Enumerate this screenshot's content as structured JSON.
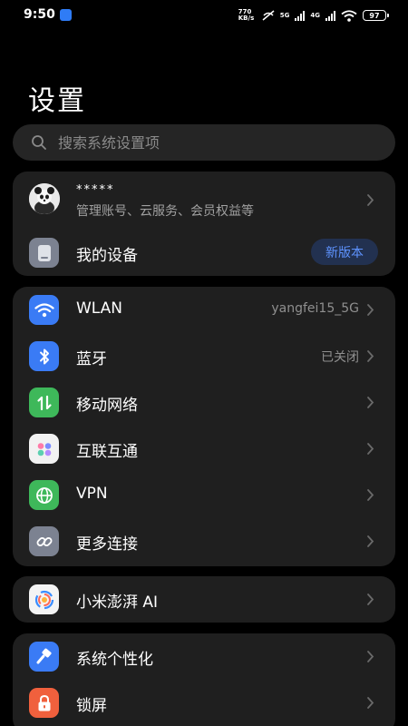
{
  "status_bar": {
    "time": "9:50",
    "net_speed_value": "770",
    "net_speed_unit": "KB/s",
    "sim1_type": "5G",
    "sim2_type": "4G",
    "battery": "97"
  },
  "page_title": "设置",
  "search": {
    "placeholder": "搜索系统设置项"
  },
  "account": {
    "name": "*****",
    "subtitle": "管理账号、云服务、会员权益等"
  },
  "my_device": {
    "label": "我的设备",
    "badge": "新版本"
  },
  "connections": [
    {
      "label": "WLAN",
      "value": "yangfei15_5G",
      "icon": "wifi-icon",
      "color": "#3a7bf5"
    },
    {
      "label": "蓝牙",
      "value": "已关闭",
      "icon": "bluetooth-icon",
      "color": "#3a7bf5"
    },
    {
      "label": "移动网络",
      "value": "",
      "icon": "mobile-data-icon",
      "color": "#3eb85a"
    },
    {
      "label": "互联互通",
      "value": "",
      "icon": "interconnect-icon",
      "color": "#f2f2f2"
    },
    {
      "label": "VPN",
      "value": "",
      "icon": "globe-icon",
      "color": "#3eb85a"
    },
    {
      "label": "更多连接",
      "value": "",
      "icon": "link-icon",
      "color": "#7c8291"
    }
  ],
  "ai": {
    "label": "小米澎湃 AI",
    "icon": "hyperai-icon"
  },
  "personalization": [
    {
      "label": "系统个性化",
      "icon": "brush-icon",
      "color": "#3a7bf5"
    },
    {
      "label": "锁屏",
      "icon": "lock-icon",
      "color": "#f0603d"
    }
  ]
}
